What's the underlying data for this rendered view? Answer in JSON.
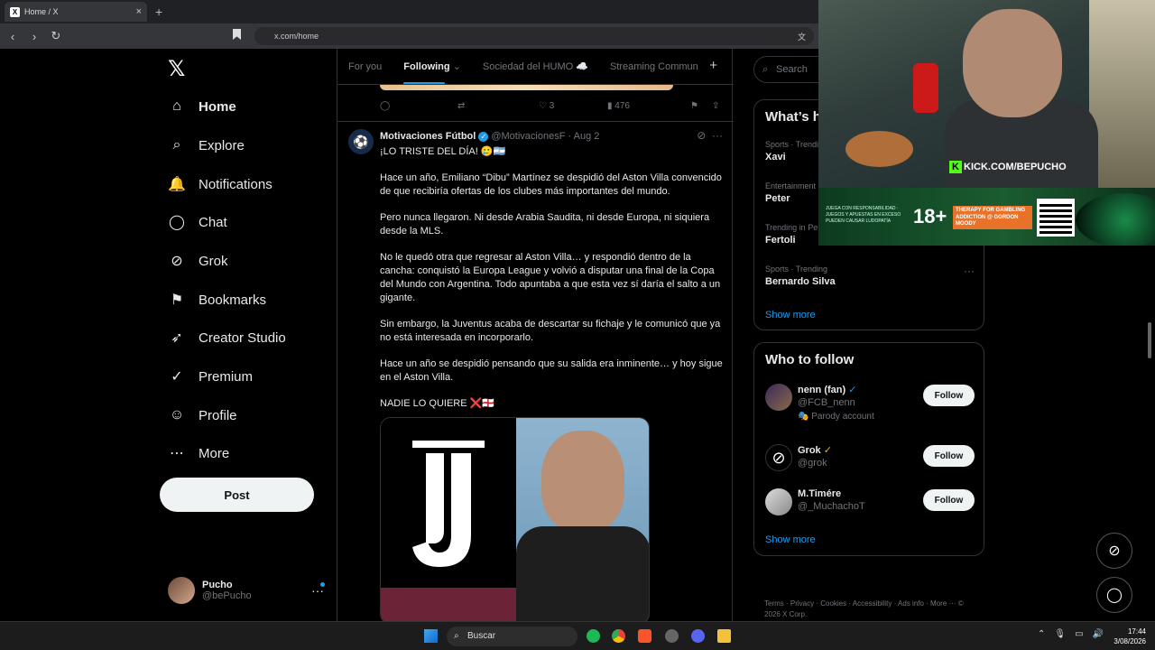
{
  "browser": {
    "tab_title": "Home / X",
    "tab_favicon": "X",
    "tab_close": "×",
    "new_tab": "+",
    "url": "x.com/home"
  },
  "sidebar": {
    "logo": "𝕏",
    "items": [
      {
        "label": "Home",
        "icon": "home-icon",
        "glyph": "⌂"
      },
      {
        "label": "Explore",
        "icon": "search-icon",
        "glyph": "⌕"
      },
      {
        "label": "Notifications",
        "icon": "bell-icon",
        "glyph": "🔔"
      },
      {
        "label": "Chat",
        "icon": "chat-icon",
        "glyph": "◯"
      },
      {
        "label": "Grok",
        "icon": "grok-icon",
        "glyph": "⊘"
      },
      {
        "label": "Bookmarks",
        "icon": "bookmark-icon",
        "glyph": "⚑"
      },
      {
        "label": "Creator Studio",
        "icon": "rocket-icon",
        "glyph": "➶"
      },
      {
        "label": "Premium",
        "icon": "verified-icon",
        "glyph": "✓"
      },
      {
        "label": "Profile",
        "icon": "person-icon",
        "glyph": "☺"
      },
      {
        "label": "More",
        "icon": "more-icon",
        "glyph": "⋯"
      }
    ],
    "post_label": "Post",
    "account": {
      "name": "Pucho",
      "handle": "@bePucho",
      "more": "···"
    }
  },
  "feed": {
    "tabs": [
      "For you",
      "Following",
      "Sociedad del HUMO ☁️",
      "Streaming Commun"
    ],
    "active_tab": "Following",
    "prev_actions": {
      "likes": "3",
      "views": "476"
    },
    "tweet": {
      "name": "Motivaciones Fútbol",
      "handle": "@MotivacionesF",
      "date": "· Aug 2",
      "paragraphs": [
        "¡LO TRISTE DEL DÍA! 🥲🇦🇷",
        "Hace un año, Emiliano “Dibu” Martínez se despidió del Aston Villa convencido de que recibiría ofertas de los clubes más importantes del mundo.",
        "Pero nunca llegaron. Ni desde Arabia Saudita, ni desde Europa, ni siquiera desde la MLS.",
        "No le quedó otra que regresar al Aston Villa… y respondió dentro de la cancha: conquistó la Europa League y volvió a disputar una final de la Copa del Mundo con Argentina. Todo apuntaba a que esta vez sí daría el salto a un gigante.",
        "Sin embargo, la Juventus acaba de descartar su fichaje y le comunicó que ya no está interesada en incorporarlo.",
        "Hace un año se despidió pensando que su salida era inminente… y hoy sigue en el Aston Villa.",
        "NADIE LO QUIERE ❌🏴󠁧󠁢󠁥󠁮󠁧󠁿"
      ]
    }
  },
  "right": {
    "search_placeholder": "Search",
    "whats": {
      "title": "What’s h",
      "trends": [
        {
          "ctx": "Sports · Trendin",
          "value": "Xavi"
        },
        {
          "ctx": "Entertainment",
          "value": "Peter"
        },
        {
          "ctx": "Trending in Pe",
          "value": "Fertoli"
        },
        {
          "ctx": "Sports · Trending",
          "value": "Bernardo Silva"
        }
      ],
      "show_more": "Show more"
    },
    "who": {
      "title": "Who to follow",
      "users": [
        {
          "name": "nenn (fan)",
          "handle": "@FCB_nenn",
          "extra": "🎭 Parody account",
          "follow": "Follow"
        },
        {
          "name": "Grok",
          "handle": "@grok",
          "extra": "",
          "follow": "Follow"
        },
        {
          "name": "M.Timére",
          "handle": "@_MuchachoT",
          "extra": "",
          "follow": "Follow"
        }
      ],
      "show_more": "Show more"
    },
    "footer": "Terms · Privacy · Cookies · Accessibility · Ads info · More ··· © 2026 X Corp."
  },
  "overlay": {
    "kick": "KICK.COM/BEPUCHO",
    "banner_small": "JUEGA CON RESPONSABILIDAD · JUEGOS Y APUESTAS EN EXCESO PUEDEN CAUSAR LUDOPATÍA",
    "banner_big": "18+",
    "banner_therapy": "THERAPY FOR GAMBLING ADDICTION @ GORDON MOODY"
  },
  "taskbar": {
    "search": "Buscar",
    "time": "17:44",
    "date": "3/08/2026"
  }
}
